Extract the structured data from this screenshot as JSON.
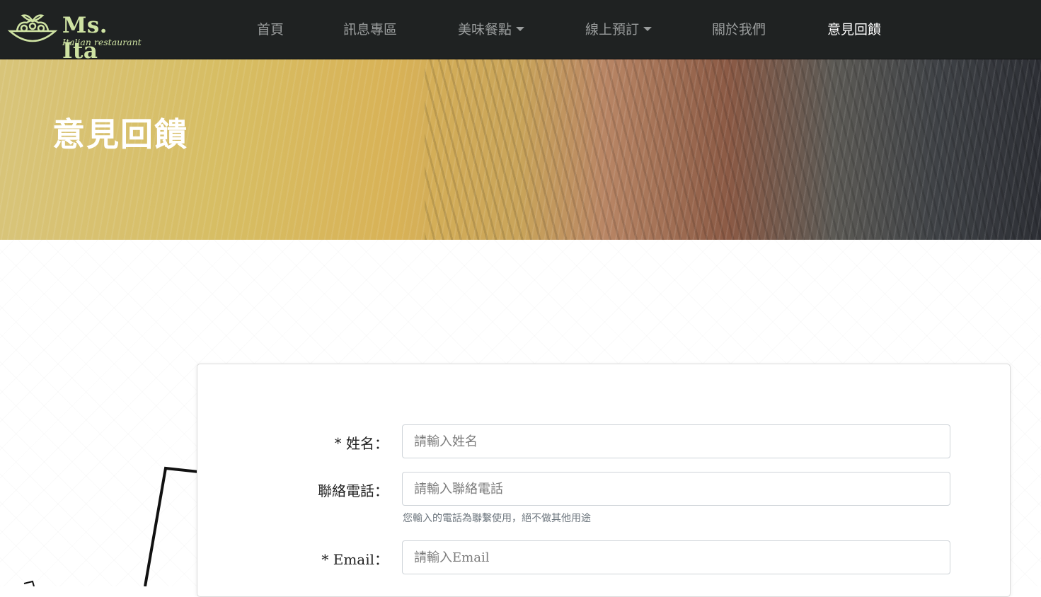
{
  "brand": {
    "name": "Ms. Ita",
    "tagline": "Italian restaurant",
    "color": "#cfe3a3"
  },
  "nav": {
    "items": [
      {
        "label": "首頁",
        "dropdown": false,
        "active": false
      },
      {
        "label": "訊息專區",
        "dropdown": false,
        "active": false
      },
      {
        "label": "美味餐點",
        "dropdown": true,
        "active": false
      },
      {
        "label": "線上預訂",
        "dropdown": true,
        "active": false
      },
      {
        "label": "關於我們",
        "dropdown": false,
        "active": false
      },
      {
        "label": "意見回饋",
        "dropdown": false,
        "active": true
      }
    ]
  },
  "hero": {
    "title": "意見回饋"
  },
  "form": {
    "name": {
      "label": "* 姓名：",
      "placeholder": "請輸入姓名",
      "value": ""
    },
    "phone": {
      "label": "聯絡電話：",
      "placeholder": "請輸入聯絡電話",
      "value": "",
      "help": "您輸入的電話為聯繫使用，絕不做其他用途"
    },
    "email": {
      "label": "* Email：",
      "placeholder": "請輸入Email",
      "value": ""
    }
  }
}
